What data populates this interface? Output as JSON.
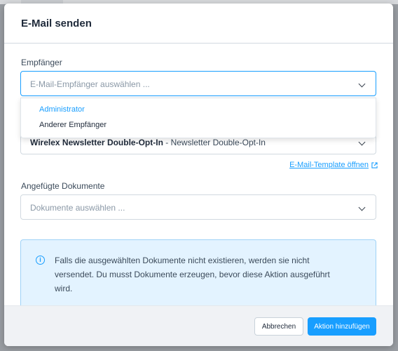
{
  "modal": {
    "title": "E-Mail senden",
    "recipient": {
      "label": "Empfänger",
      "placeholder": "E-Mail-Empfänger auswählen ...",
      "options": [
        "Administrator",
        "Anderer Empfänger"
      ]
    },
    "template": {
      "name": "Wirelex Newsletter Double-Opt-In",
      "detail": " - Newsletter Double-Opt-In",
      "link": "E-Mail-Template öffnen",
      "link_icon": "external-link-icon"
    },
    "documents": {
      "label": "Angefügte Dokumente",
      "placeholder": "Dokumente auswählen ..."
    },
    "info": {
      "icon": "info-icon",
      "text": "Falls die ausgewählten Dokumente nicht existieren, werden sie nicht versendet. Du musst Dokumente erzeugen, bevor diese Aktion ausgeführt wird."
    },
    "footer": {
      "cancel": "Abbrechen",
      "submit": "Aktion hinzufügen"
    }
  },
  "colors": {
    "accent": "#189eff",
    "info_background": "#e3f3ff",
    "footer_background": "#f0f2f5"
  }
}
